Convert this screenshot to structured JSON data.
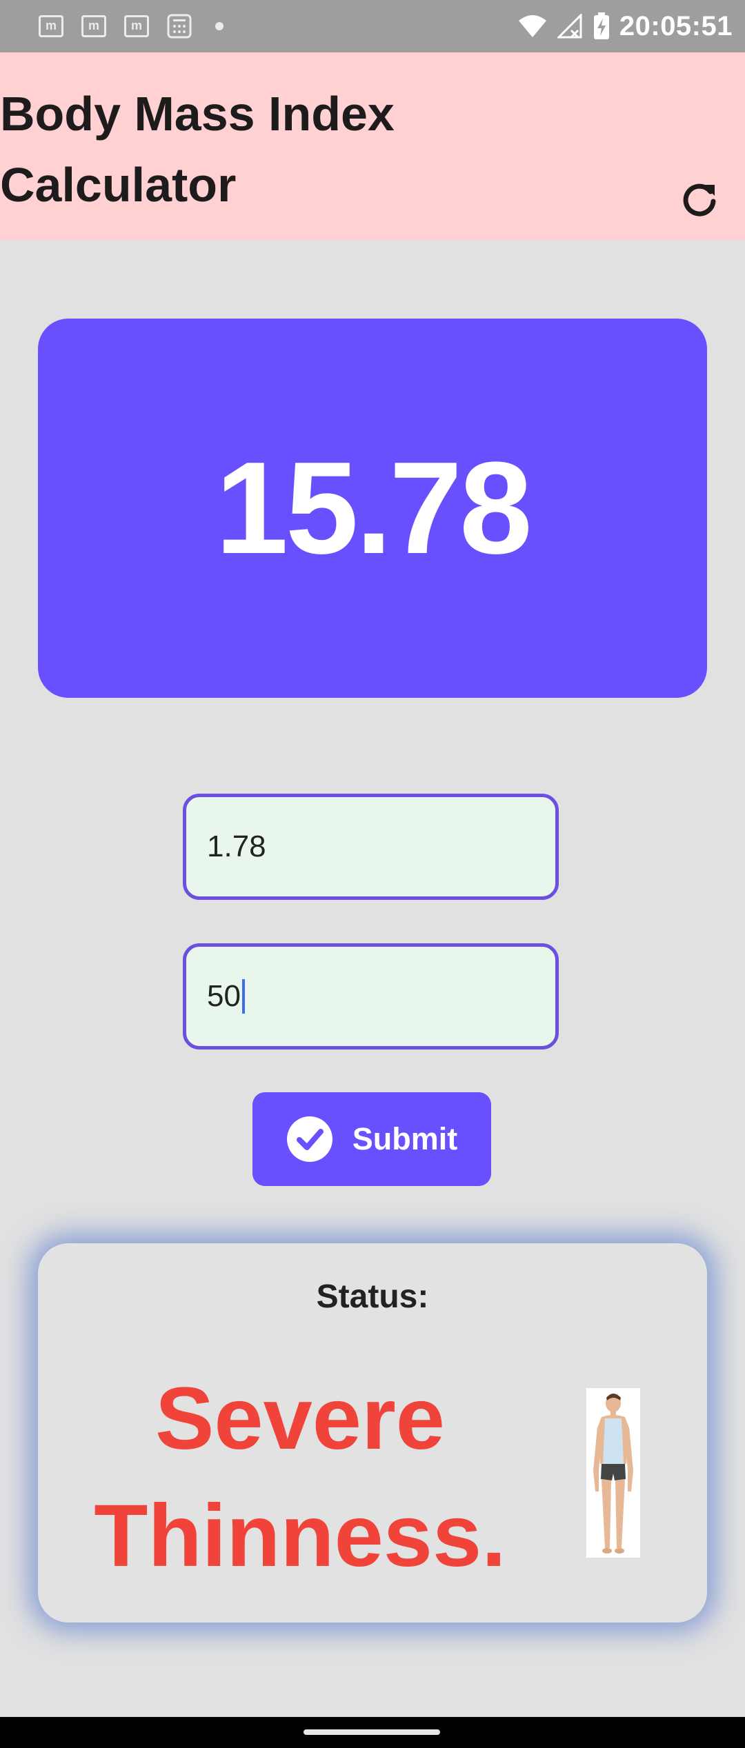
{
  "status_bar": {
    "time": "20:05:51",
    "notification_icons": [
      "m",
      "m",
      "m"
    ]
  },
  "app_bar": {
    "title": "Body Mass Index\nCalculator",
    "refresh_icon": "refresh-icon",
    "background_color": "#ffd1d3"
  },
  "result": {
    "bmi_value": "15.78",
    "card_color": "#6850ff"
  },
  "form": {
    "height_value": "1.78",
    "weight_value": "50",
    "submit_label": "Submit",
    "submit_icon": "check-circle-icon"
  },
  "status": {
    "label": "Status:",
    "result_text": "Severe Thinness.",
    "result_color": "#f0443a",
    "figure_icon": "body-figure-icon"
  }
}
